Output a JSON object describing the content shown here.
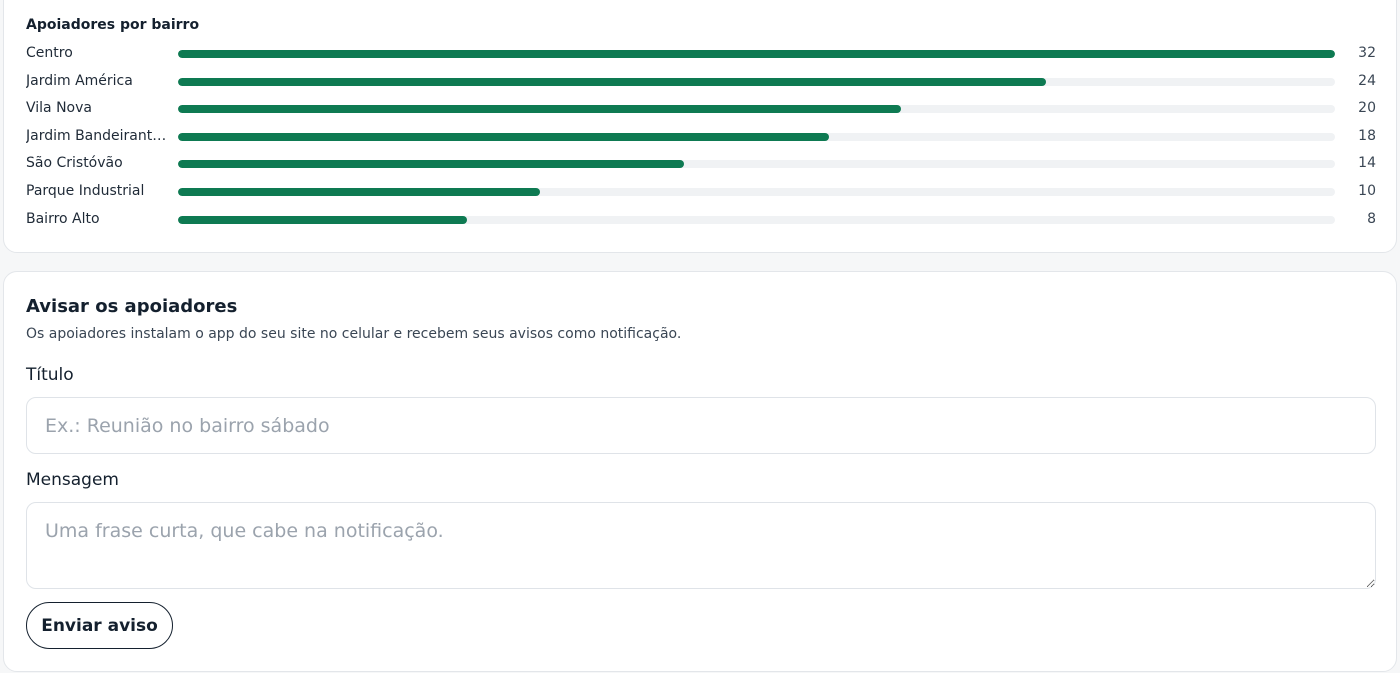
{
  "stats": {
    "title": "Apoiadores por bairro",
    "max": 32,
    "rows": [
      {
        "label": "Centro",
        "value": 32
      },
      {
        "label": "Jardim América",
        "value": 24
      },
      {
        "label": "Vila Nova",
        "value": 20
      },
      {
        "label": "Jardim Bandeirant…",
        "value": 18
      },
      {
        "label": "São Cristóvão",
        "value": 14
      },
      {
        "label": "Parque Industrial",
        "value": 10
      },
      {
        "label": "Bairro Alto",
        "value": 8
      }
    ],
    "bar_color": "#0e7a52"
  },
  "notify": {
    "title": "Avisar os apoiadores",
    "description": "Os apoiadores instalam o app do seu site no celular e recebem seus avisos como notificação.",
    "title_label": "Título",
    "title_placeholder": "Ex.: Reunião no bairro sábado",
    "message_label": "Mensagem",
    "message_placeholder": "Uma frase curta, que cabe na notificação.",
    "send_label": "Enviar aviso"
  }
}
